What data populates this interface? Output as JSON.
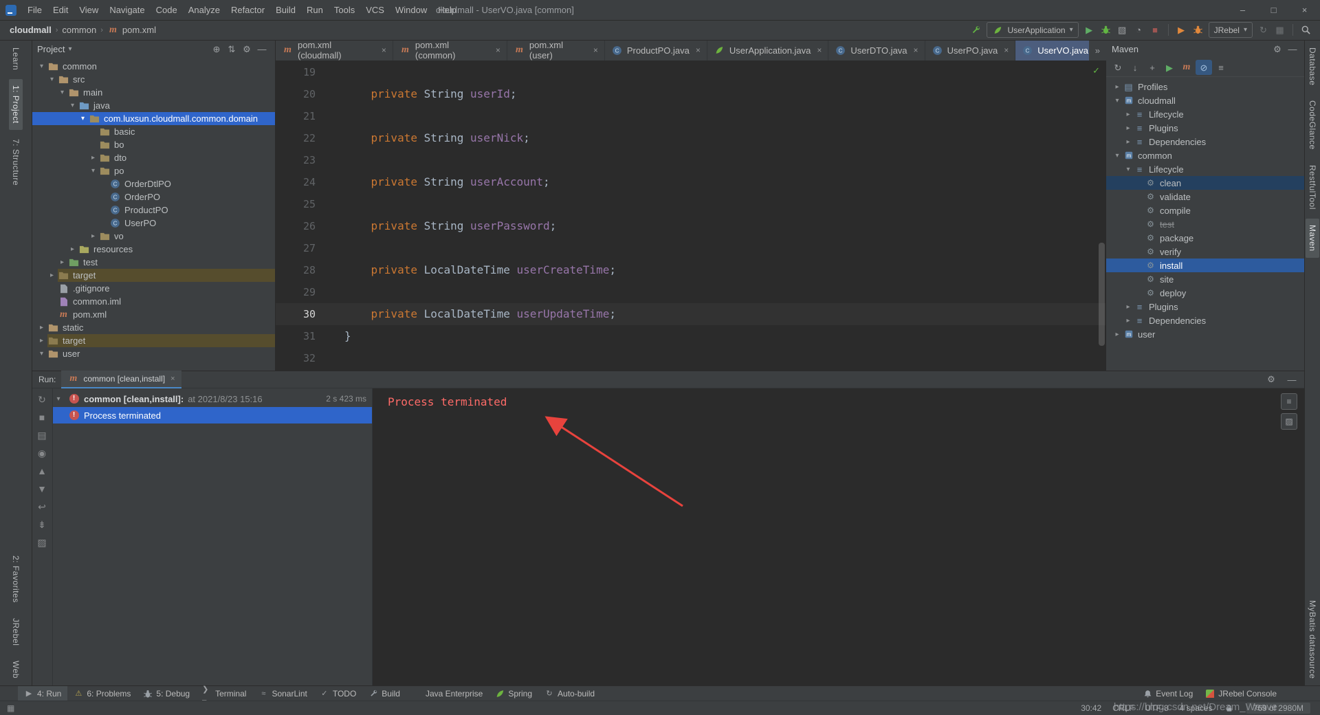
{
  "colors": {
    "selection_blue": "#2f65ca",
    "maven_selection_blue": "#2d5b9e",
    "error_red": "#ff6b68",
    "arrow_red": "#e8433d",
    "excluded_bg": "#564d2d",
    "keyword_orange": "#cc7832",
    "field_purple": "#9876aa",
    "code_text": "#a9b7c6",
    "spring_green": "#6db33f"
  },
  "window": {
    "title": "cloudmall - UserVO.java [common]",
    "menus": [
      "File",
      "Edit",
      "View",
      "Navigate",
      "Code",
      "Analyze",
      "Refactor",
      "Build",
      "Run",
      "Tools",
      "VCS",
      "Window",
      "Help"
    ],
    "controls": [
      {
        "name": "minimize-icon",
        "glyph": "–"
      },
      {
        "name": "maximize-icon",
        "glyph": "□"
      },
      {
        "name": "close-icon",
        "glyph": "×"
      }
    ]
  },
  "toolbar": {
    "breadcrumbs": [
      "cloudmall",
      "common",
      "pom.xml"
    ],
    "run_config": "UserApplication",
    "jrebel": "JRebel",
    "icon_groups": {
      "g1": [
        "build-wrench-icon"
      ],
      "g2": [
        "run-icon",
        "debug-icon",
        "coverage-icon",
        "profiler-icon",
        "stop-run-icon"
      ],
      "g3": [
        "jrebel-run-icon",
        "jrebel-debug-icon"
      ],
      "g4": [
        "update-app-icon",
        "layout-grid-icon"
      ],
      "g5": [
        "search-everywhere-icon"
      ]
    }
  },
  "stripes": {
    "left_top": [
      {
        "label": "Learn"
      },
      {
        "label": "1: Project",
        "active": true
      },
      {
        "label": "7: Structure"
      }
    ],
    "left_bottom": [
      {
        "label": "2: Favorites"
      },
      {
        "label": "JRebel"
      },
      {
        "label": "Web"
      }
    ],
    "right_top": [
      {
        "label": "Database"
      },
      {
        "label": "CodeGlance"
      },
      {
        "label": "RestfulTool"
      },
      {
        "label": "Maven",
        "active": true
      }
    ],
    "right_bottom": [
      {
        "label": "MyBatis datasource"
      }
    ]
  },
  "project": {
    "title": "Project",
    "header_icons": [
      "locate-icon",
      "scroll-from-source-icon",
      "gear-icon",
      "hide-icon"
    ],
    "tree": [
      {
        "label": "common",
        "level": 0,
        "icon": "module-icon",
        "chev": "d"
      },
      {
        "label": "src",
        "level": 1,
        "icon": "folder-icon",
        "chev": "d"
      },
      {
        "label": "main",
        "level": 2,
        "icon": "folder-icon",
        "chev": "d"
      },
      {
        "label": "java",
        "level": 3,
        "icon": "source-folder-icon",
        "chev": "d"
      },
      {
        "label": "com.luxsun.cloudmall.common.domain",
        "level": 4,
        "icon": "package-icon",
        "chev": "d",
        "sel": true
      },
      {
        "label": "basic",
        "level": 5,
        "icon": "package-icon"
      },
      {
        "label": "bo",
        "level": 5,
        "icon": "package-icon"
      },
      {
        "label": "dto",
        "level": 5,
        "icon": "package-icon",
        "chev": "r"
      },
      {
        "label": "po",
        "level": 5,
        "icon": "package-icon",
        "chev": "d"
      },
      {
        "label": "OrderDtlPO",
        "level": 6,
        "icon": "class-icon"
      },
      {
        "label": "OrderPO",
        "level": 6,
        "icon": "class-icon"
      },
      {
        "label": "ProductPO",
        "level": 6,
        "icon": "class-icon"
      },
      {
        "label": "UserPO",
        "level": 6,
        "icon": "class-icon"
      },
      {
        "label": "vo",
        "level": 5,
        "icon": "package-icon",
        "chev": "r"
      },
      {
        "label": "resources",
        "level": 3,
        "icon": "resources-folder-icon",
        "chev": "r"
      },
      {
        "label": "test",
        "level": 2,
        "icon": "test-folder-icon",
        "chev": "r"
      },
      {
        "label": "target",
        "level": 1,
        "icon": "excluded-folder-icon",
        "chev": "r",
        "excl": true
      },
      {
        "label": ".gitignore",
        "level": 1,
        "icon": "gitignore-file-icon"
      },
      {
        "label": "common.iml",
        "level": 1,
        "icon": "iml-file-icon"
      },
      {
        "label": "pom.xml",
        "level": 1,
        "icon": "maven-icon"
      },
      {
        "label": "static",
        "level": 0,
        "icon": "module-icon",
        "chev": "r"
      },
      {
        "label": "target",
        "level": 0,
        "icon": "excluded-folder-icon",
        "chev": "r",
        "excl": true
      },
      {
        "label": "user",
        "level": 0,
        "icon": "module-icon",
        "chev": "d"
      }
    ]
  },
  "tabs": [
    {
      "label": "pom.xml (cloudmall)",
      "icon": "maven-icon"
    },
    {
      "label": "pom.xml (common)",
      "icon": "maven-icon"
    },
    {
      "label": "pom.xml (user)",
      "icon": "maven-icon"
    },
    {
      "label": "ProductPO.java",
      "icon": "class-icon"
    },
    {
      "label": "UserApplication.java",
      "icon": "spring-icon"
    },
    {
      "label": "UserDTO.java",
      "icon": "class-icon"
    },
    {
      "label": "UserPO.java",
      "icon": "class-icon"
    },
    {
      "label": "UserVO.java",
      "icon": "class-icon",
      "active": true
    }
  ],
  "tabs_overflow": "»",
  "editor": {
    "lines": [
      {
        "num": 19,
        "segs": []
      },
      {
        "num": 20,
        "segs": [
          {
            "c": "plain",
            "t": "    "
          },
          {
            "c": "kw",
            "t": "private"
          },
          {
            "c": "plain",
            "t": " String "
          },
          {
            "c": "field",
            "t": "userId"
          },
          {
            "c": "plain",
            "t": ";"
          }
        ]
      },
      {
        "num": 21,
        "segs": []
      },
      {
        "num": 22,
        "segs": [
          {
            "c": "plain",
            "t": "    "
          },
          {
            "c": "kw",
            "t": "private"
          },
          {
            "c": "plain",
            "t": " String "
          },
          {
            "c": "field",
            "t": "userNick"
          },
          {
            "c": "plain",
            "t": ";"
          }
        ]
      },
      {
        "num": 23,
        "segs": []
      },
      {
        "num": 24,
        "segs": [
          {
            "c": "plain",
            "t": "    "
          },
          {
            "c": "kw",
            "t": "private"
          },
          {
            "c": "plain",
            "t": " String "
          },
          {
            "c": "field",
            "t": "userAccount"
          },
          {
            "c": "plain",
            "t": ";"
          }
        ]
      },
      {
        "num": 25,
        "segs": []
      },
      {
        "num": 26,
        "segs": [
          {
            "c": "plain",
            "t": "    "
          },
          {
            "c": "kw",
            "t": "private"
          },
          {
            "c": "plain",
            "t": " String "
          },
          {
            "c": "field",
            "t": "userPassword"
          },
          {
            "c": "plain",
            "t": ";"
          }
        ]
      },
      {
        "num": 27,
        "segs": []
      },
      {
        "num": 28,
        "segs": [
          {
            "c": "plain",
            "t": "    "
          },
          {
            "c": "kw",
            "t": "private"
          },
          {
            "c": "plain",
            "t": " LocalDateTime "
          },
          {
            "c": "field",
            "t": "userCreateTime"
          },
          {
            "c": "plain",
            "t": ";"
          }
        ]
      },
      {
        "num": 29,
        "segs": []
      },
      {
        "num": 30,
        "current": true,
        "segs": [
          {
            "c": "plain",
            "t": "    "
          },
          {
            "c": "kw",
            "t": "private"
          },
          {
            "c": "plain",
            "t": " LocalDateTime "
          },
          {
            "c": "field",
            "t": "userUpdateTime"
          },
          {
            "c": "plain",
            "t": ";"
          }
        ]
      },
      {
        "num": 31,
        "segs": [
          {
            "c": "plain",
            "t": "}"
          }
        ]
      },
      {
        "num": 32,
        "segs": []
      }
    ]
  },
  "maven": {
    "title": "Maven",
    "header_icons": [
      "gear-icon",
      "hide-icon"
    ],
    "toolbar_icons": [
      {
        "icon": "refresh-icon"
      },
      {
        "icon": "download-sources-icon"
      },
      {
        "icon": "plus-icon"
      },
      {
        "icon": "run-maven-icon"
      },
      {
        "icon": "execute-goal-icon"
      },
      {
        "icon": "skip-tests-icon",
        "active": true
      },
      {
        "icon": "dependencies-list-icon"
      }
    ],
    "tree": [
      {
        "label": "Profiles",
        "level": 0,
        "icon": "profiles-icon",
        "chev": "r"
      },
      {
        "label": "cloudmall",
        "level": 0,
        "icon": "maven-module-icon",
        "chev": "d"
      },
      {
        "label": "Lifecycle",
        "level": 1,
        "icon": "lifecycle-icon",
        "chev": "r"
      },
      {
        "label": "Plugins",
        "level": 1,
        "icon": "plugins-icon",
        "chev": "r"
      },
      {
        "label": "Dependencies",
        "level": 1,
        "icon": "dependencies-icon",
        "chev": "r"
      },
      {
        "label": "common",
        "level": 0,
        "icon": "maven-module-icon",
        "chev": "d"
      },
      {
        "label": "Lifecycle",
        "level": 1,
        "icon": "lifecycle-icon",
        "chev": "d"
      },
      {
        "label": "clean",
        "level": 2,
        "icon": "goal-icon",
        "soft": true
      },
      {
        "label": "validate",
        "level": 2,
        "icon": "goal-icon"
      },
      {
        "label": "compile",
        "level": 2,
        "icon": "goal-icon"
      },
      {
        "label": "test",
        "level": 2,
        "icon": "goal-icon",
        "struck": true
      },
      {
        "label": "package",
        "level": 2,
        "icon": "goal-icon"
      },
      {
        "label": "verify",
        "level": 2,
        "icon": "goal-icon"
      },
      {
        "label": "install",
        "level": 2,
        "icon": "goal-icon",
        "sel": true
      },
      {
        "label": "site",
        "level": 2,
        "icon": "goal-icon"
      },
      {
        "label": "deploy",
        "level": 2,
        "icon": "goal-icon"
      },
      {
        "label": "Plugins",
        "level": 1,
        "icon": "plugins-icon",
        "chev": "r"
      },
      {
        "label": "Dependencies",
        "level": 1,
        "icon": "dependencies-icon",
        "chev": "r"
      },
      {
        "label": "user",
        "level": 0,
        "icon": "maven-module-icon",
        "chev": "r"
      }
    ]
  },
  "run_panel": {
    "label": "Run:",
    "tab": {
      "label": "common [clean,install]",
      "icon": "maven-icon"
    },
    "header_icons": [
      "gear-icon",
      "hide-icon"
    ],
    "strip_icons": [
      "rerun-icon",
      "stop-icon",
      "restore-layout-icon",
      "pin-icon",
      "up-stack-icon",
      "down-stack-icon",
      "soft-wrap-icon",
      "scroll-end-icon",
      "clear-icon"
    ],
    "console_icons": [
      "console-settings-icon",
      "console-clear-icon"
    ],
    "root_label": "common [clean,install]:",
    "root_suffix": " at 2021/8/23 15:16",
    "duration": "2 s 423 ms",
    "child_label": "Process terminated",
    "console_text": "Process terminated"
  },
  "tw_bar": {
    "left": [
      {
        "label": "4: Run",
        "icon": "run-tw-icon",
        "active": true
      },
      {
        "label": "6: Problems",
        "icon": "problems-icon"
      },
      {
        "label": "5: Debug",
        "icon": "debug-tw-icon"
      },
      {
        "label": "Terminal",
        "icon": "terminal-icon"
      },
      {
        "label": "SonarLint",
        "icon": "sonarlint-icon"
      },
      {
        "label": "TODO",
        "icon": "todo-icon"
      },
      {
        "label": "Build",
        "icon": "build-tw-icon"
      },
      {
        "label": "Java Enterprise",
        "icon": "javaee-icon"
      },
      {
        "label": "Spring",
        "icon": "spring-tw-icon"
      },
      {
        "label": "Auto-build",
        "icon": "autobuild-icon"
      }
    ],
    "right": [
      {
        "label": "Event Log",
        "icon": "eventlog-icon"
      },
      {
        "label": "JRebel Console",
        "icon": "jrebel-console-icon"
      }
    ]
  },
  "status_bar": {
    "caret": "30:42",
    "line_ending": "CRLF",
    "encoding": "UTF-8",
    "indent": "4 spaces",
    "memory": "769 of 2980M"
  },
  "watermark": "https://blog.csdn.net/Dream_Weave"
}
